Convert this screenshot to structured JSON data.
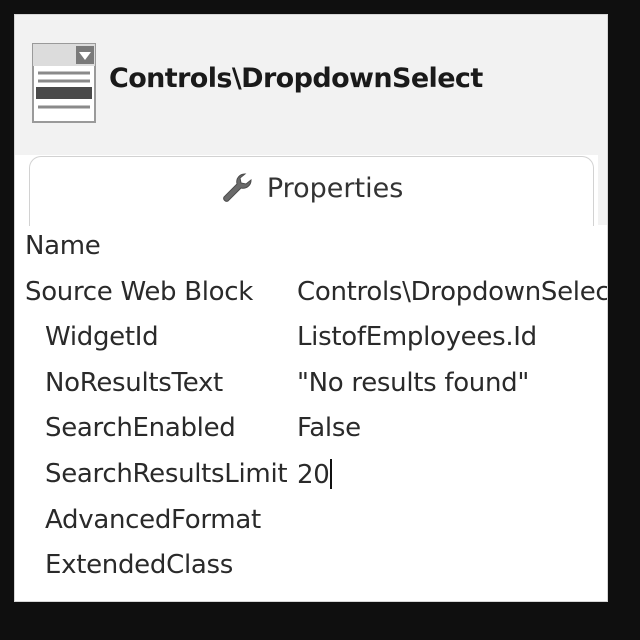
{
  "header": {
    "title": "Controls\\DropdownSelect",
    "icon": "dropdown-widget-icon"
  },
  "tab": {
    "label": "Properties",
    "icon": "wrench-icon"
  },
  "properties": [
    {
      "name": "Name",
      "value": "",
      "indent": false
    },
    {
      "name": "Source Web Block",
      "value": "Controls\\DropdownSelect",
      "indent": false
    },
    {
      "name": "WidgetId",
      "value": "ListofEmployees.Id",
      "indent": true
    },
    {
      "name": "NoResultsText",
      "value": "\"No results found\"",
      "indent": true
    },
    {
      "name": "SearchEnabled",
      "value": "False",
      "indent": true
    },
    {
      "name": "SearchResultsLimit",
      "value": "20",
      "indent": true,
      "editing": true
    },
    {
      "name": "AdvancedFormat",
      "value": "",
      "indent": true
    },
    {
      "name": "ExtendedClass",
      "value": "",
      "indent": true
    }
  ]
}
